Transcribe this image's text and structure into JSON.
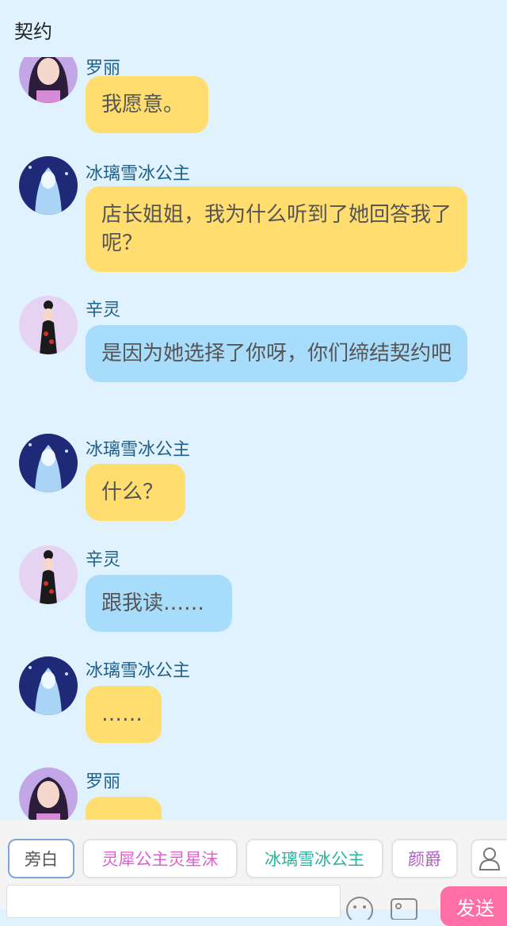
{
  "header": {
    "title": "契约"
  },
  "messages": [
    {
      "sender": "罗丽",
      "text": "我愿意。",
      "color": "#ffdd6e",
      "avatar": "luoli-avatar"
    },
    {
      "sender": "冰璃雪冰公主",
      "text": "店长姐姐，我为什么听到了她回答我了呢？",
      "color": "#ffdd6e",
      "avatar": "binglixue-avatar"
    },
    {
      "sender": "辛灵",
      "text": "是因为她选择了你呀，你们缔结契约吧",
      "color": "#a8dcfb",
      "avatar": "xinling-avatar"
    },
    {
      "sender": "冰璃雪冰公主",
      "text": "什么？",
      "color": "#ffdd6e",
      "avatar": "binglixue-avatar"
    },
    {
      "sender": "辛灵",
      "text": "跟我读……",
      "color": "#a8dcfb",
      "avatar": "xinling-avatar"
    },
    {
      "sender": "冰璃雪冰公主",
      "text": "……",
      "color": "#ffdd6e",
      "avatar": "binglixue-avatar"
    },
    {
      "sender": "罗丽",
      "text": "",
      "color": "#ffdd6e",
      "avatar": "luoli-avatar"
    }
  ],
  "characters": [
    {
      "label": "旁白",
      "color": "#555555"
    },
    {
      "label": "灵犀公主灵星沫",
      "color": "#e05fd0"
    },
    {
      "label": "冰璃雪冰公主",
      "color": "#29b39f"
    },
    {
      "label": "颜爵",
      "color": "#b05fc8"
    }
  ],
  "composer": {
    "send_label": "发送"
  }
}
